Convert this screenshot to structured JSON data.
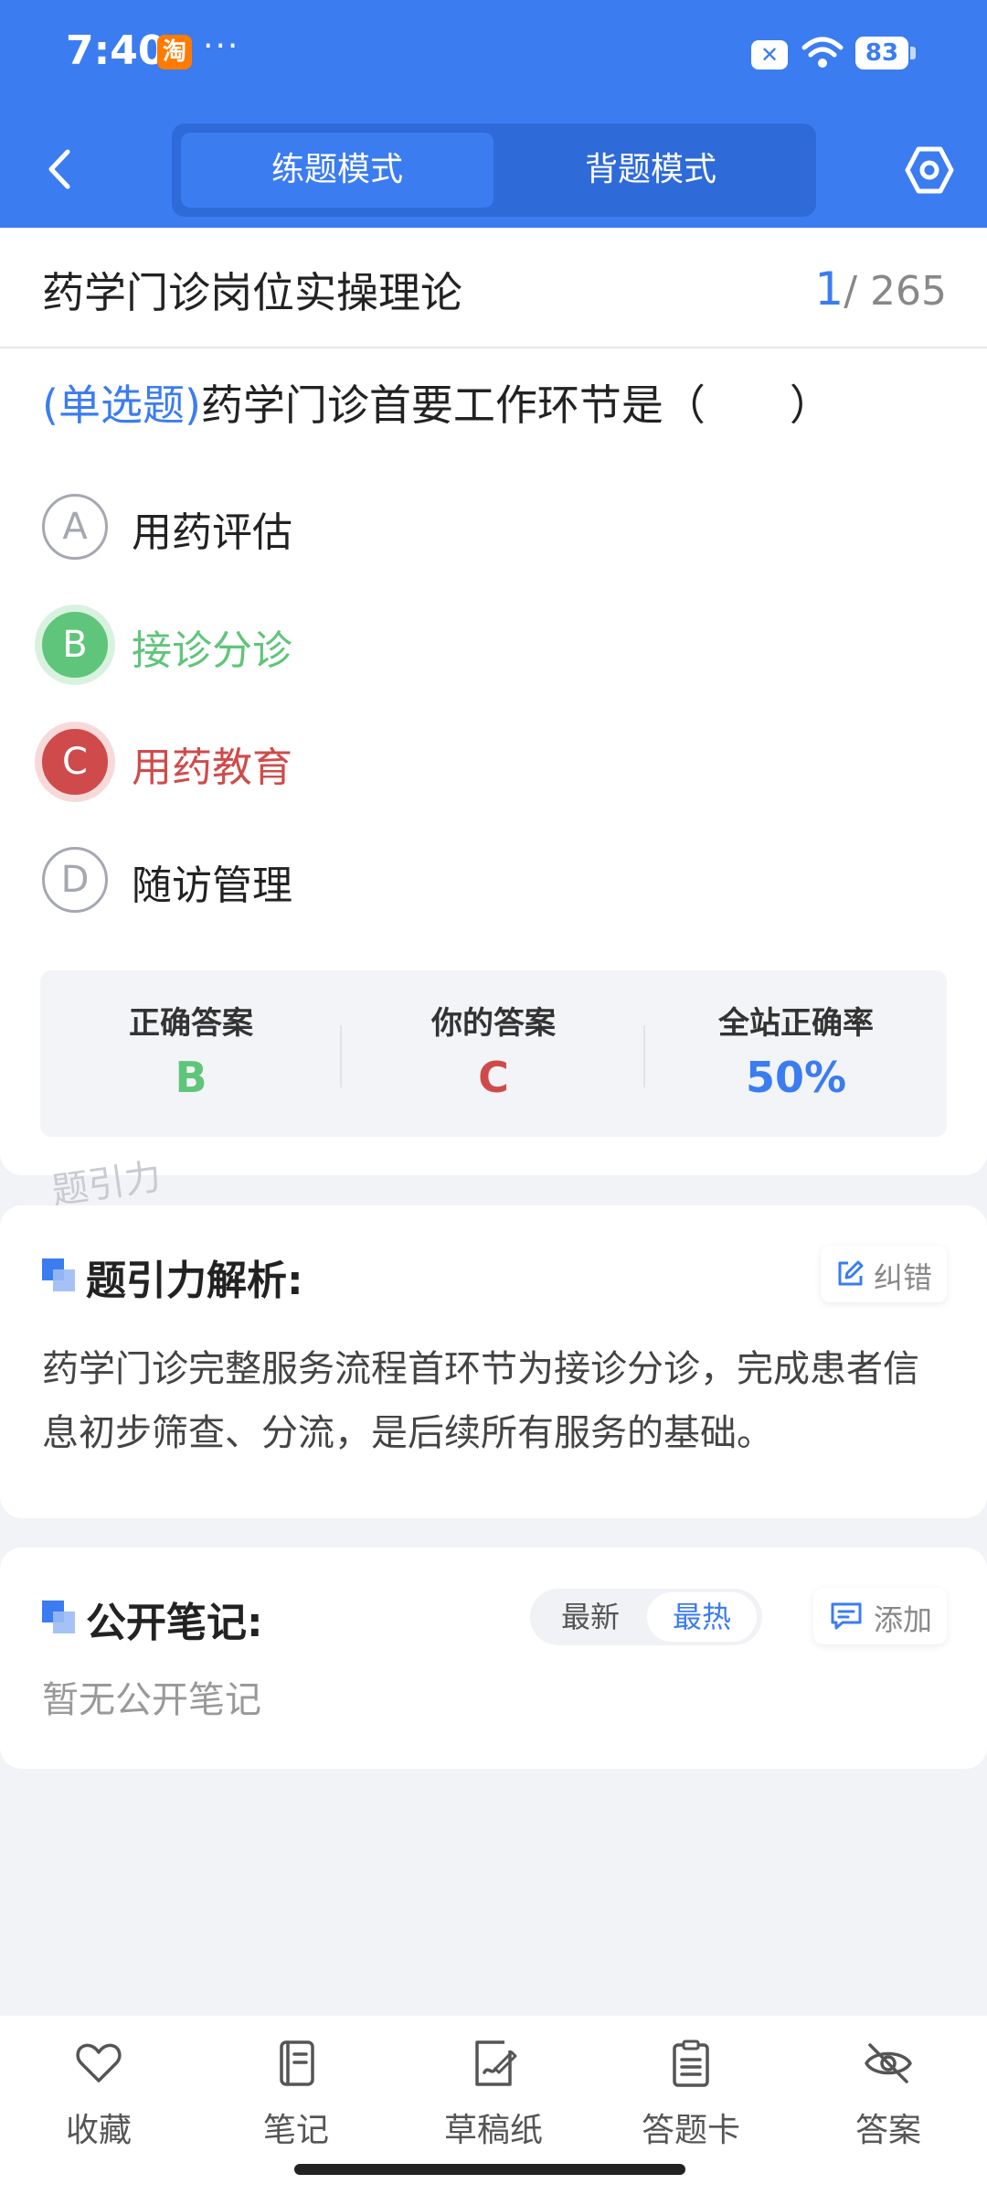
{
  "status_bar": {
    "time": "7:40",
    "app_badge": "淘",
    "overflow": "···",
    "battery": "83"
  },
  "header": {
    "tabs": [
      {
        "label": "练题模式",
        "active": true
      },
      {
        "label": "背题模式",
        "active": false
      }
    ],
    "back_icon": "chevron-left-icon",
    "settings_icon": "hexagon-settings-icon",
    "accent_color": "#3b7cf0"
  },
  "course": {
    "title": "药学门诊岗位实操理论",
    "current": "1",
    "total": "/ 265"
  },
  "question": {
    "type_label": "(单选题)",
    "text": "药学门诊首要工作环节是（　　）",
    "options": [
      {
        "letter": "A",
        "text": "用药评估",
        "state": "normal"
      },
      {
        "letter": "B",
        "text": "接诊分诊",
        "state": "correct"
      },
      {
        "letter": "C",
        "text": "用药教育",
        "state": "wrong"
      },
      {
        "letter": "D",
        "text": "随访管理",
        "state": "normal"
      }
    ],
    "correct_color": "#5fc57a",
    "wrong_color": "#cf4b4b"
  },
  "answer_summary": {
    "correct_label": "正确答案",
    "correct_value": "B",
    "yours_label": "你的答案",
    "yours_value": "C",
    "rate_label": "全站正确率",
    "rate_value": "50%"
  },
  "watermark": "题引力",
  "analysis": {
    "title": "题引力解析:",
    "correct_button": "纠错",
    "text": "药学门诊完整服务流程首环节为接诊分诊，完成患者信息初步筛查、分流，是后续所有服务的基础。"
  },
  "notes": {
    "title": "公开笔记:",
    "sort_latest": "最新",
    "sort_hot": "最热",
    "add_button": "添加",
    "empty_text": "暂无公开笔记"
  },
  "bottom_nav": [
    {
      "label": "收藏",
      "icon": "heart-icon"
    },
    {
      "label": "笔记",
      "icon": "notebook-icon"
    },
    {
      "label": "草稿纸",
      "icon": "draft-paper-icon"
    },
    {
      "label": "答题卡",
      "icon": "answer-sheet-icon"
    },
    {
      "label": "答案",
      "icon": "eye-off-icon"
    }
  ]
}
